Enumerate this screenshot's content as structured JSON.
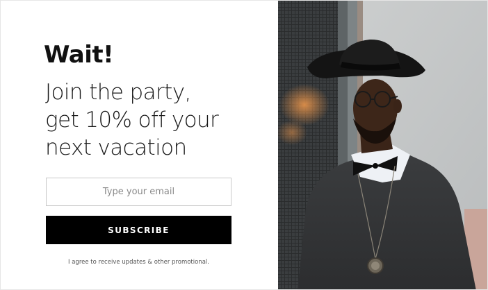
{
  "popup": {
    "heading": "Wait!",
    "subheading_lines": [
      "Join the party,",
      "get 10% off your",
      "next vacation"
    ],
    "email": {
      "placeholder": "Type your email",
      "value": ""
    },
    "subscribe_label": "SUBSCRIBE",
    "consent_text": "I agree to receive updates & other promotional."
  },
  "photo": {
    "subject": "man-in-black-hat-portrait"
  },
  "colors": {
    "button_bg": "#000000",
    "button_text": "#ffffff",
    "heading_text": "#111111"
  }
}
